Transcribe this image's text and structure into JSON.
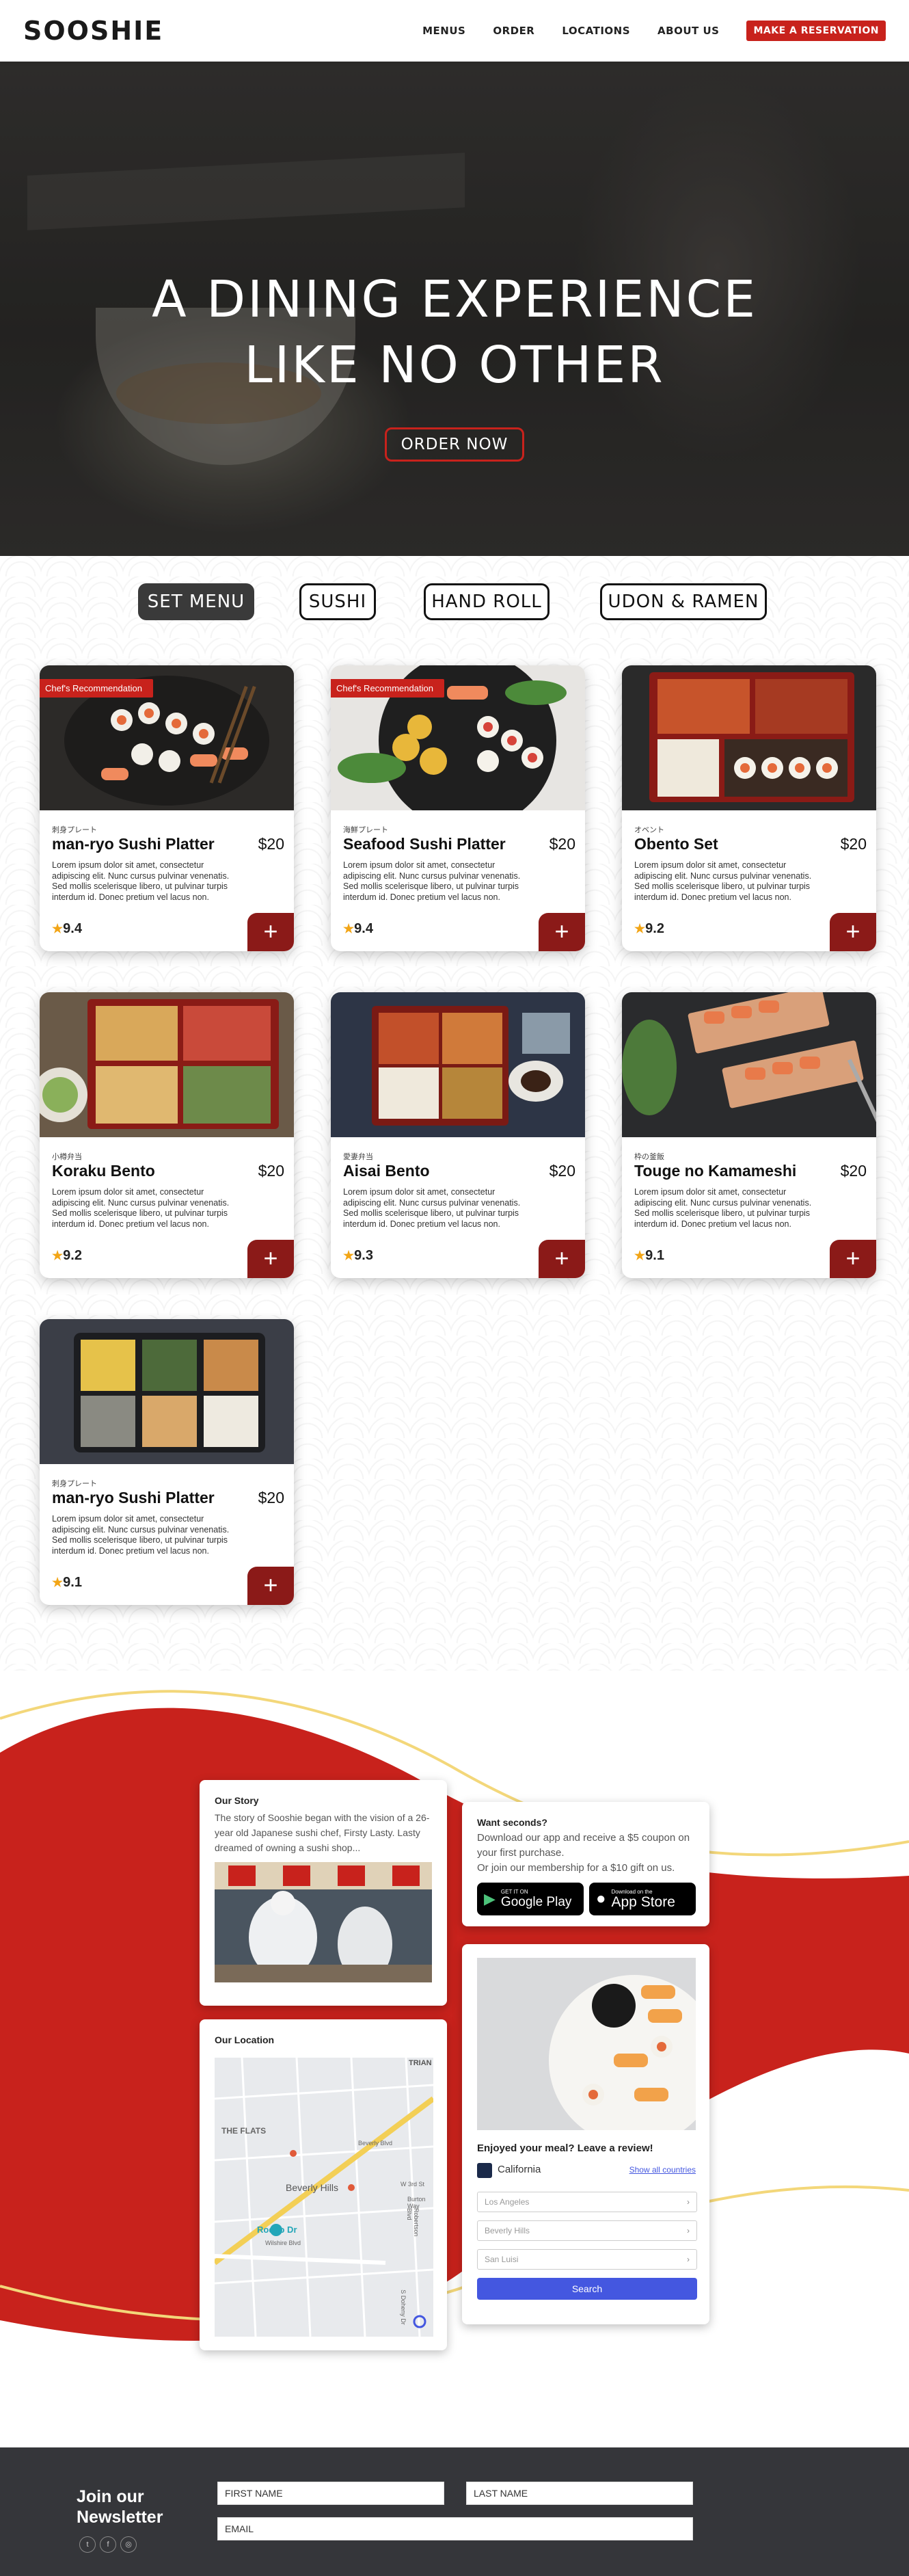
{
  "header": {
    "logo": "SOOSHIE",
    "nav": [
      "MENUS",
      "ORDER",
      "LOCATIONS",
      "ABOUT US"
    ],
    "reserve_label": "MAKE A RESERVATION"
  },
  "hero": {
    "title_line1": "A DINING EXPERIENCE",
    "title_line2": "LIKE NO OTHER",
    "cta": "ORDER NOW"
  },
  "tabs": [
    "SET MENU",
    "SUSHI",
    "HAND ROLL",
    "UDON & RAMEN"
  ],
  "active_tab": "SET MENU",
  "menu_items": [
    {
      "badge": "Chef's Recommendation",
      "subtitle": "刺身プレート",
      "name": "man-ryo Sushi Platter",
      "price": "$20",
      "rating": "9.4"
    },
    {
      "badge": "Chef's Recommendation",
      "subtitle": "海鮮プレート",
      "name": "Seafood Sushi Platter",
      "price": "$20",
      "rating": "9.4"
    },
    {
      "badge": "",
      "subtitle": "オベント",
      "name": "Obento Set",
      "price": "$20",
      "rating": "9.2"
    },
    {
      "badge": "",
      "subtitle": "小樽弁当",
      "name": "Koraku Bento",
      "price": "$20",
      "rating": "9.2"
    },
    {
      "badge": "",
      "subtitle": "愛妻弁当",
      "name": "Aisai Bento",
      "price": "$20",
      "rating": "9.3"
    },
    {
      "badge": "",
      "subtitle": "枠の釜飯",
      "name": "Touge no Kamameshi",
      "price": "$20",
      "rating": "9.1"
    },
    {
      "badge": "",
      "subtitle": "刺身プレート",
      "name": "man-ryo Sushi Platter",
      "price": "$20",
      "rating": "9.1"
    }
  ],
  "card_description": "Lorem ipsum dolor sit amet, consectetur adipiscing elit. Nunc cursus pulvinar venenatis. Sed mollis scelerisque libero, ut pulvinar turpis interdum id. Donec pretium vel lacus non.",
  "add_label": "+",
  "story": {
    "title": "Our Story",
    "text": "The story of Sooshie began with the vision of a 26-year old Japanese sushi chef, Firsty Lasty. Lasty dreamed of owning a sushi shop..."
  },
  "location": {
    "title": "Our Location",
    "map_labels": [
      "TRIAN",
      "THE FLATS",
      "Beverly Hills",
      "Rodeo Dr",
      "Wilshire Blvd",
      "Beverly Blvd",
      "W 3rd St",
      "Burton Way",
      "Robertson Blvd",
      "S Doheny Dr"
    ]
  },
  "app_promo": {
    "title": "Want seconds?",
    "text": "Download our app and receive a $5 coupon on your first purchase.",
    "text2": "Or join our membership for a $10 gift on us.",
    "google_small": "GET IT ON",
    "google_big": "Google Play",
    "apple_small": "Download on the",
    "apple_big": "App Store"
  },
  "review": {
    "title": "Enjoyed your meal? Leave a review!",
    "state": "California",
    "show_all": "Show all countries",
    "cities": [
      "Los Angeles",
      "Beverly Hills",
      "San Luisi"
    ],
    "search_label": "Search"
  },
  "footer": {
    "title_line1": "Join our",
    "title_line2": "Newsletter",
    "social": [
      "t",
      "f",
      "◎"
    ],
    "first_name": "FIRST NAME",
    "last_name": "LAST NAME",
    "email": "EMAIL"
  },
  "colors": {
    "brand_red": "#c8221c",
    "dark_red": "#8b1a18",
    "search_blue": "#4457e0",
    "footer_bg": "#35363a",
    "gold_line": "#f3d77a"
  }
}
